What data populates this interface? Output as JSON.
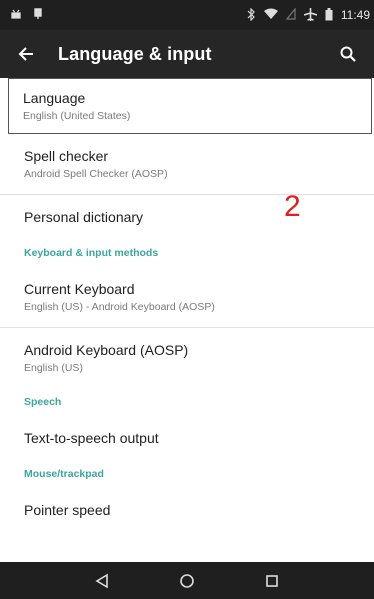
{
  "status_bar": {
    "time": "11:49",
    "icons": [
      "android-notification-icon",
      "android-notification-icon",
      "bluetooth-icon",
      "wifi-icon",
      "no-sim-icon",
      "airplane-icon",
      "battery-icon"
    ]
  },
  "app_bar": {
    "title": "Language & input"
  },
  "items": [
    {
      "title": "Language",
      "summary": "English (United States)"
    },
    {
      "title": "Spell checker",
      "summary": "Android Spell Checker (AOSP)"
    },
    {
      "title": "Personal dictionary"
    },
    {
      "category": "Keyboard & input methods"
    },
    {
      "title": "Current Keyboard",
      "summary": "English (US) - Android Keyboard (AOSP)"
    },
    {
      "title": "Android Keyboard (AOSP)",
      "summary": "English (US)"
    },
    {
      "category": "Speech"
    },
    {
      "title": "Text-to-speech output"
    },
    {
      "category": "Mouse/trackpad"
    },
    {
      "title": "Pointer speed"
    }
  ],
  "annotation": "2",
  "colors": {
    "status_bar": "#1f1f1f",
    "app_bar": "#262626",
    "accent": "#3aa69a",
    "annotation": "#e02020"
  }
}
